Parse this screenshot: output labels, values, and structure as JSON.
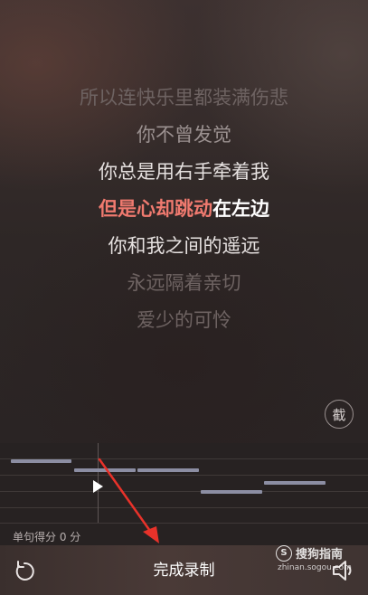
{
  "lyrics": {
    "line1": "所以连快乐里都装满伤悲",
    "line2": "你不曾发觉",
    "line3": "你总是用右手牵着我",
    "current_sung": "但是心却跳动",
    "current_rest": "在左边",
    "line5": "你和我之间的遥远",
    "line6": "永远隔着亲切",
    "line7": "爱少的可怜"
  },
  "capture_button": {
    "label": "截"
  },
  "pitch": {
    "score_text": "单句得分 0 分"
  },
  "bottom_bar": {
    "finish_label": "完成录制",
    "undo_icon": "undo-icon",
    "volume_icon": "volume-icon"
  },
  "watermark": {
    "logo": "S",
    "name": "搜狗指南",
    "url": "zhinan.sogou.com"
  },
  "colors": {
    "sung": "#f07a6f",
    "note": "#8c8ea3",
    "annotation_arrow": "#e8322a"
  }
}
